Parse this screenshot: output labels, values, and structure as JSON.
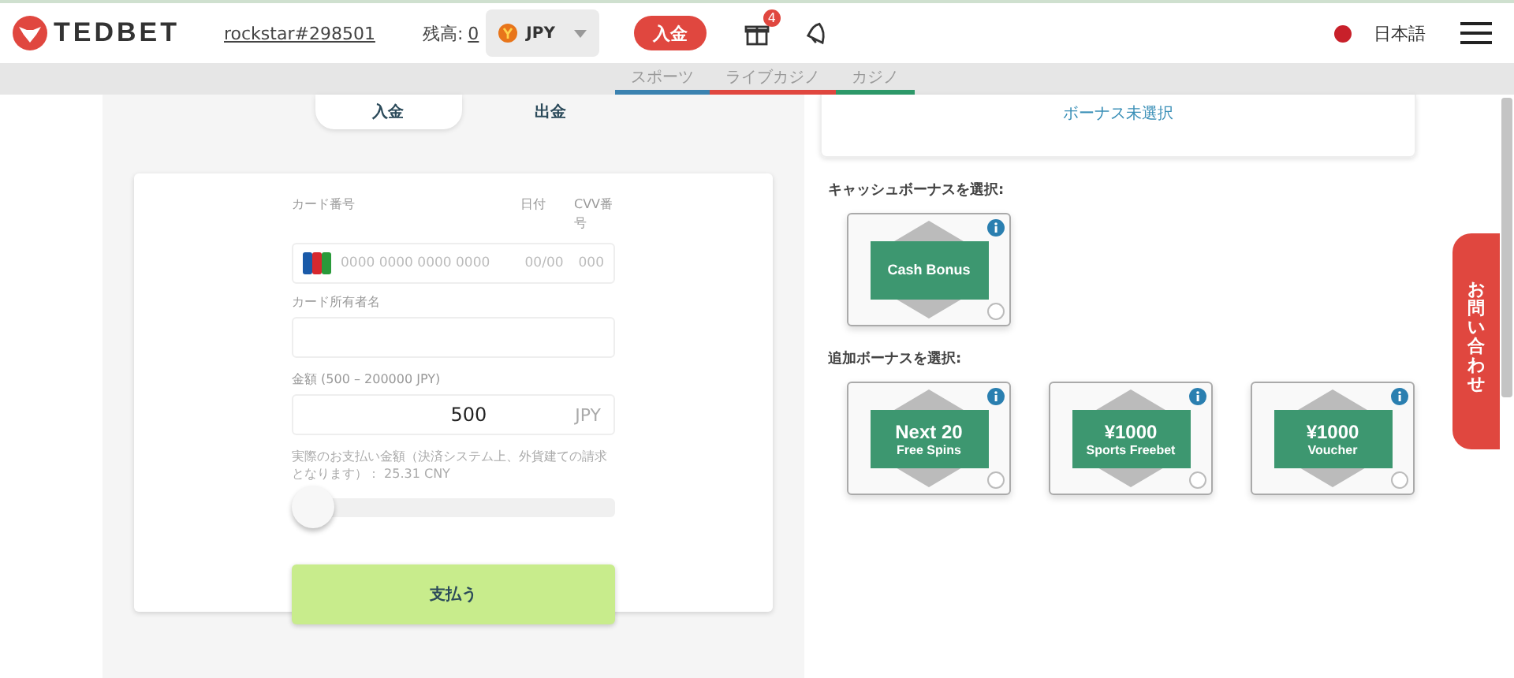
{
  "header": {
    "logo": "TEDBET",
    "username": "rockstar#298501",
    "balance_label": "残高:",
    "balance_value": "0",
    "currency": "JPY",
    "deposit_button": "入金",
    "gift_badge": "4",
    "language": "日本語"
  },
  "nav_tabs": [
    {
      "label": "スポーツ",
      "color": "#3b82b0"
    },
    {
      "label": "ライブカジノ",
      "color": "#e0473f"
    },
    {
      "label": "カジノ",
      "color": "#2e9a6a"
    }
  ],
  "mode_tabs": [
    {
      "label": "入金",
      "selected": true
    },
    {
      "label": "出金",
      "selected": false
    }
  ],
  "card_form": {
    "card_number_label": "カード番号",
    "date_label": "日付",
    "cvv_label": "CVV番号",
    "card_number_placeholder": "0000 0000 0000 0000",
    "date_placeholder": "00/00",
    "cvv_placeholder": "000",
    "holder_label": "カード所有者名",
    "amount_label": "金額 (500 – 200000 JPY)",
    "amount_value": "500",
    "amount_currency": "JPY",
    "note": "実際のお支払い金額（決済システム上、外貨建ての請求となります）： 25.31 CNY",
    "slider": {
      "level": 0
    },
    "pay_button": "支払う"
  },
  "bonus_status": "ボーナス未選択",
  "cash_bonus": {
    "heading": "キャッシュボーナスを選択:",
    "items": [
      {
        "title": "Cash Bonus",
        "selected": false
      }
    ]
  },
  "extra_bonus": {
    "heading": "追加ボーナスを選択:",
    "items": [
      {
        "title": "Next 20",
        "subtitle": "Free Spins",
        "selected": false
      },
      {
        "title": "¥1000",
        "subtitle": "Sports Freebet",
        "selected": false
      },
      {
        "title": "¥1000",
        "subtitle": "Voucher",
        "selected": false
      }
    ]
  },
  "contact_tab": "お問い合わせ"
}
